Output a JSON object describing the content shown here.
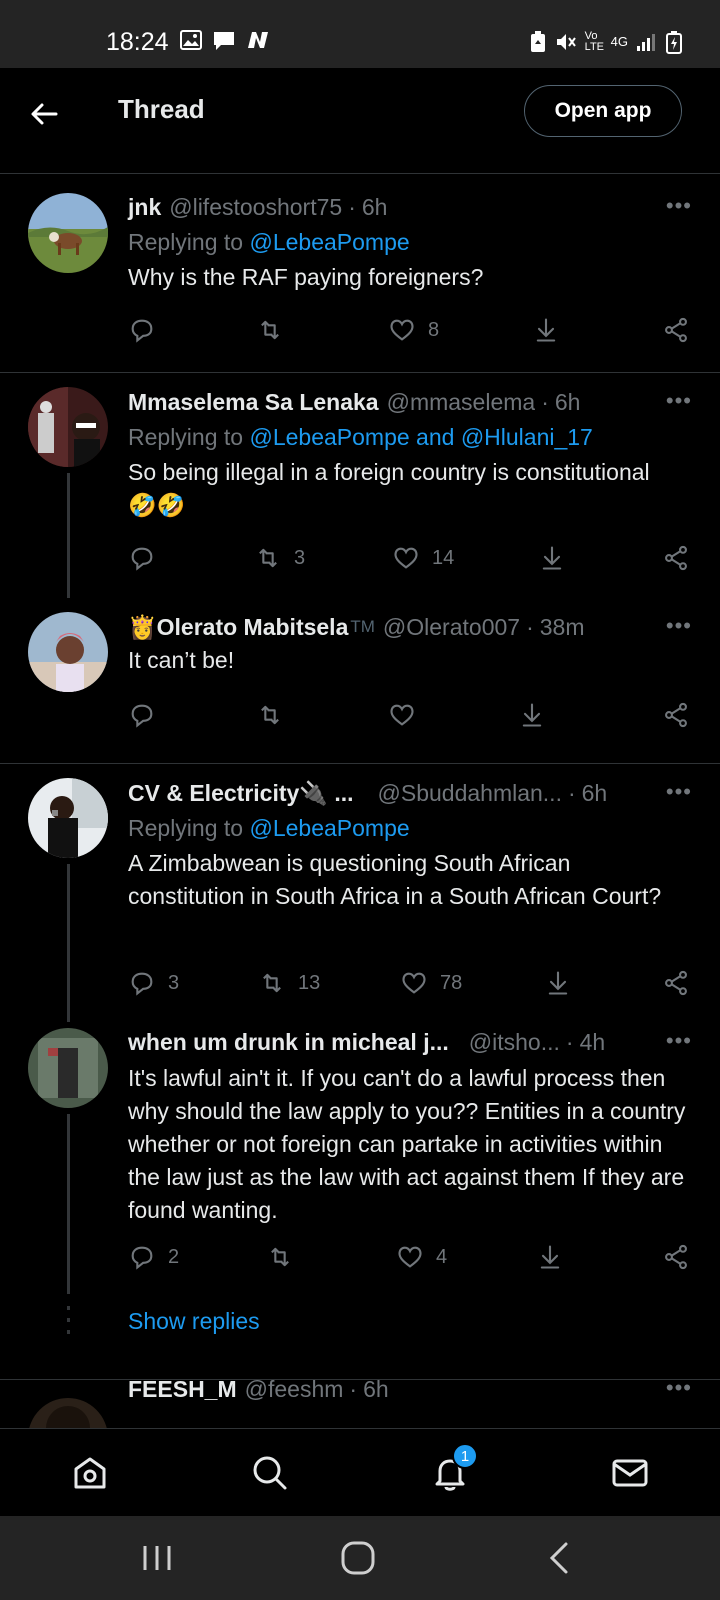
{
  "status_bar": {
    "time": "18:24",
    "left_icons": [
      "image-icon",
      "message-icon",
      "n-app-icon"
    ],
    "right_icons": [
      "battery-saver-icon",
      "mute-icon",
      "volte-icon",
      "4g-icon",
      "signal-icon",
      "battery-icon"
    ],
    "volte": "Vo LTE",
    "network": "4G"
  },
  "top_bar": {
    "title": "Thread",
    "open_app_label": "Open app"
  },
  "colors": {
    "accent": "#1d9bf0",
    "background": "#000000",
    "muted": "#71767b",
    "text": "#e7e9ea"
  },
  "tweets": [
    {
      "name": "jnk",
      "handle": "@lifestooshort75",
      "time": "6h",
      "replying_prefix": "Replying to",
      "mentions": [
        "@LebeaPompe"
      ],
      "mention_join": "",
      "text": "Why is the RAF paying foreigners?",
      "replies": "",
      "retweets": "",
      "likes": "8"
    },
    {
      "name": "Mmaselema Sa Lenaka",
      "handle": "@mmaselema",
      "time": "6h",
      "replying_prefix": "Replying to",
      "mentions": [
        "@LebeaPompe",
        "@Hlulani_17"
      ],
      "mention_join": "and",
      "text": "So being illegal in a foreign country is constitutional",
      "text_emoji": "🤣🤣",
      "replies": "",
      "retweets": "3",
      "likes": "14"
    },
    {
      "name_emoji": "👸",
      "name": "Olerato Mabitsela",
      "name_suffix": "TM",
      "handle": "@Olerato007",
      "time": "38m",
      "text": "It can’t be!",
      "replies": "",
      "retweets": "",
      "likes": ""
    },
    {
      "name": "CV & Electricity🔌 ...",
      "handle": "@Sbuddahmlan...",
      "time": "6h",
      "replying_prefix": "Replying to",
      "mentions": [
        "@LebeaPompe"
      ],
      "text": "A Zimbabwean is questioning South African constitution in South Africa in a South African Court?",
      "replies": "3",
      "retweets": "13",
      "likes": "78"
    },
    {
      "name": "when um drunk in micheal j...",
      "handle": "@itsho...",
      "time": "4h",
      "text": "It's lawful ain't it. If you can't do a lawful process then why should the law apply to you?? Entities in a country whether or not foreign can partake in activities within the law just as the law with act against them If they are found wanting.",
      "replies": "2",
      "retweets": "",
      "likes": "4"
    },
    {
      "name": "FEESH_M",
      "handle": "@feeshm",
      "time": "6h"
    }
  ],
  "show_replies_label": "Show replies",
  "more_label": "•••",
  "dot_sep": "·",
  "notification_count": "1"
}
